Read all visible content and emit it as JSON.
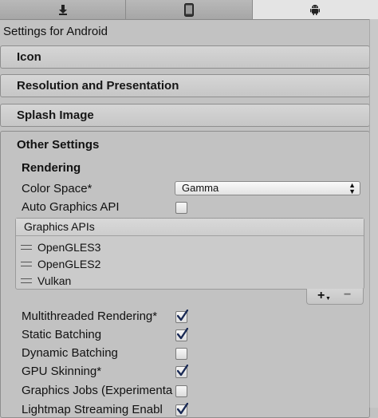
{
  "tabs": [
    {
      "icon": "download-icon"
    },
    {
      "icon": "phone-icon"
    },
    {
      "icon": "android-icon",
      "active": true
    }
  ],
  "platform_title": "Settings for Android",
  "sections": {
    "icon": "Icon",
    "resolution": "Resolution and Presentation",
    "splash": "Splash Image",
    "other": "Other Settings"
  },
  "rendering": {
    "heading": "Rendering",
    "color_space_label": "Color Space*",
    "color_space_value": "Gamma",
    "auto_graphics_label": "Auto Graphics API",
    "auto_graphics_checked": false,
    "graphics_apis_header": "Graphics APIs",
    "graphics_apis": [
      "OpenGLES3",
      "OpenGLES2",
      "Vulkan"
    ],
    "add_label": "+",
    "remove_label": "−",
    "options": [
      {
        "label": "Multithreaded Rendering*",
        "checked": true
      },
      {
        "label": "Static Batching",
        "checked": true
      },
      {
        "label": "Dynamic Batching",
        "checked": false
      },
      {
        "label": "GPU Skinning*",
        "checked": true
      },
      {
        "label": "Graphics Jobs (Experimenta",
        "checked": false
      },
      {
        "label": "Lightmap Streaming Enabl",
        "checked": true
      }
    ]
  }
}
